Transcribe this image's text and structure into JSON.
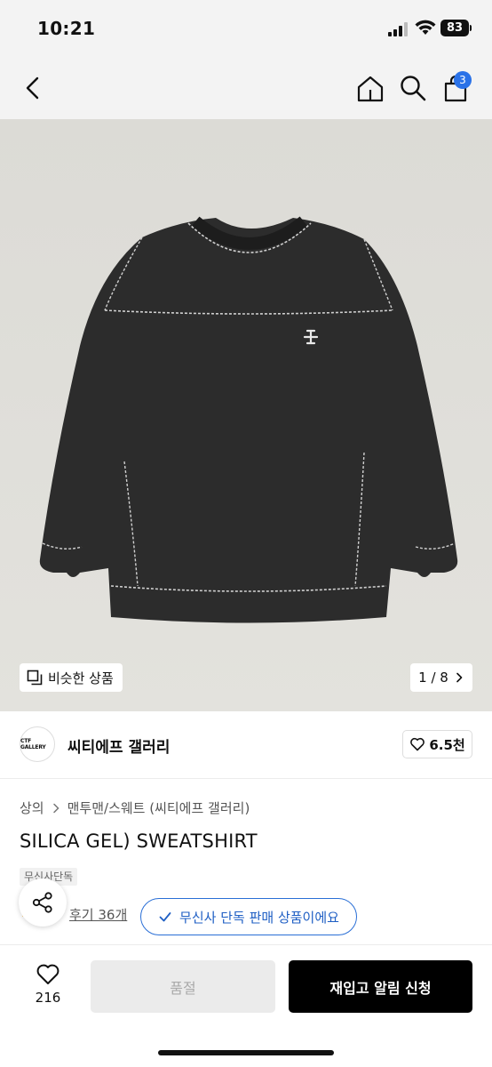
{
  "status_bar": {
    "time": "10:21",
    "battery": "83"
  },
  "nav": {
    "cart_count": "3"
  },
  "gallery": {
    "similar_label": "비슷한 상품",
    "pager": "1 / 8"
  },
  "brand": {
    "logo_text": "CTF GALLERY",
    "name": "씨티에프 갤러리",
    "likes": "6.5천"
  },
  "product": {
    "breadcrumb": [
      "상의",
      "맨투맨/스웨트 (씨티에프 갤러리)"
    ],
    "title": "SILICA GEL) SWEATSHIRT",
    "tag": "무신사단독",
    "review_link": "후기 36개",
    "exclusive_chip": "무신사 단독 판매 상품이에요"
  },
  "bottom_bar": {
    "wish_count": "216",
    "soldout_label": "품절",
    "restock_label": "재입고 알림 신청"
  },
  "colors": {
    "accent_blue": "#2a72e8",
    "chip_blue": "#1f5fc4",
    "shirt": "#2b2b2b",
    "stitch": "#cfcfcf"
  }
}
